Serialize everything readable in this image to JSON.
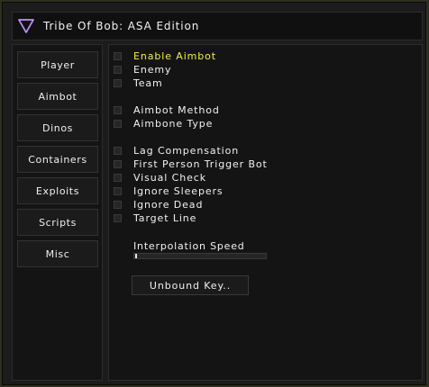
{
  "window": {
    "title": "Tribe Of Bob: ASA Edition",
    "logo_icon": "triangle-down-icon",
    "accent_color": "#8a5cc4"
  },
  "sidebar": {
    "items": [
      {
        "label": "Player"
      },
      {
        "label": "Aimbot"
      },
      {
        "label": "Dinos"
      },
      {
        "label": "Containers"
      },
      {
        "label": "Exploits"
      },
      {
        "label": "Scripts"
      },
      {
        "label": "Misc"
      }
    ]
  },
  "options": [
    {
      "label": "Enable Aimbot",
      "checked": false,
      "highlight": true
    },
    {
      "label": "Enemy",
      "checked": false
    },
    {
      "label": "Team",
      "checked": false
    },
    {
      "label": "Aimbot Method",
      "checked": false
    },
    {
      "label": "Aimbone Type",
      "checked": false
    },
    {
      "label": "Lag Compensation",
      "checked": false
    },
    {
      "label": "First Person Trigger Bot",
      "checked": false
    },
    {
      "label": "Visual Check",
      "checked": false
    },
    {
      "label": "Ignore Sleepers",
      "checked": false
    },
    {
      "label": "Ignore Dead",
      "checked": false
    },
    {
      "label": "Target Line",
      "checked": false
    }
  ],
  "slider": {
    "label": "Interpolation Speed",
    "value_fraction": 0.0
  },
  "keybind": {
    "label": "Unbound Key.."
  },
  "colors": {
    "highlight_text": "#f3ef3c",
    "panel_bg": "#141414"
  }
}
